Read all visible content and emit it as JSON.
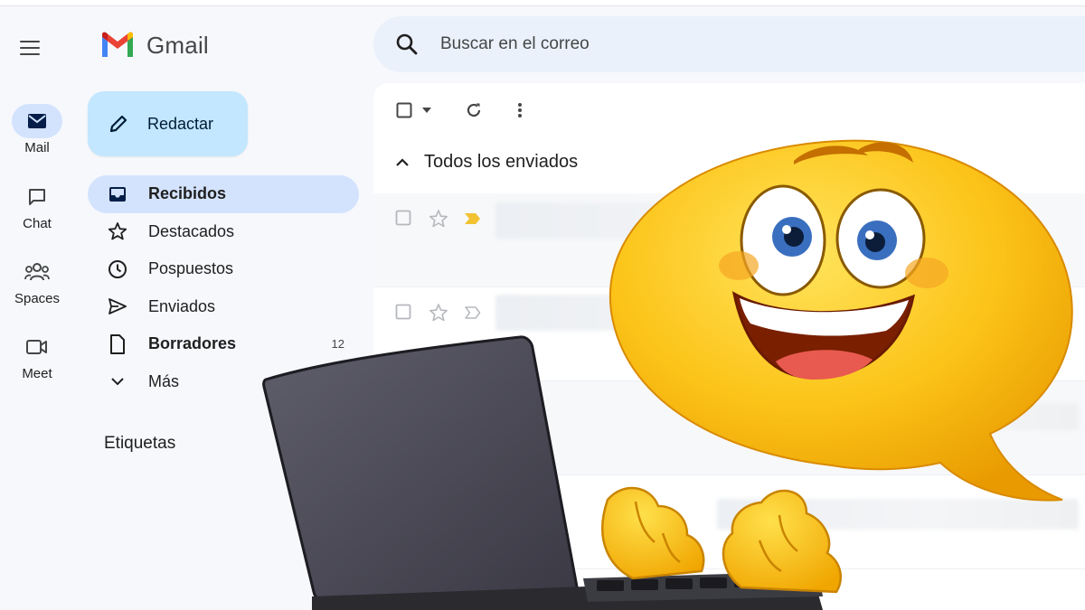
{
  "app": {
    "name": "Gmail"
  },
  "rail": {
    "items": [
      {
        "label": "Mail",
        "icon": "mail-icon",
        "active": true
      },
      {
        "label": "Chat",
        "icon": "chat-icon",
        "active": false
      },
      {
        "label": "Spaces",
        "icon": "spaces-icon",
        "active": false
      },
      {
        "label": "Meet",
        "icon": "meet-icon",
        "active": false
      }
    ]
  },
  "compose": {
    "label": "Redactar",
    "icon": "pencil-icon"
  },
  "nav": {
    "items": [
      {
        "label": "Recibidos",
        "icon": "inbox-icon",
        "bold": true,
        "active": true,
        "count": ""
      },
      {
        "label": "Destacados",
        "icon": "star-icon",
        "bold": false,
        "active": false,
        "count": ""
      },
      {
        "label": "Pospuestos",
        "icon": "clock-icon",
        "bold": false,
        "active": false,
        "count": ""
      },
      {
        "label": "Enviados",
        "icon": "send-icon",
        "bold": false,
        "active": false,
        "count": ""
      },
      {
        "label": "Borradores",
        "icon": "draft-icon",
        "bold": true,
        "active": false,
        "count": "12"
      },
      {
        "label": "Más",
        "icon": "chevron-down-icon",
        "bold": false,
        "active": false,
        "count": ""
      }
    ],
    "labels_title": "Etiquetas"
  },
  "search": {
    "placeholder": "Buscar en el correo",
    "icon": "search-icon"
  },
  "toolbar": {
    "icons": [
      "select-checkbox-icon",
      "caret-down-icon",
      "refresh-icon",
      "more-vert-icon"
    ]
  },
  "section": {
    "title": "Todos los enviados",
    "icon": "chevron-up-icon"
  },
  "colors": {
    "accent": "#c2e7ff",
    "active_nav": "#d3e3fd",
    "background": "#f6f8fc",
    "search_bg": "#eaf1fb",
    "importance_marker": "#f2c232",
    "emoji_face": "#f7b500"
  }
}
